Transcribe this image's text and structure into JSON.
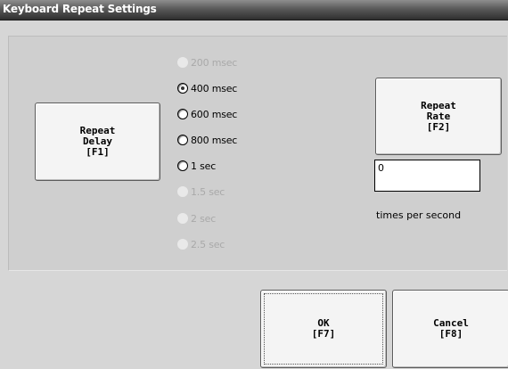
{
  "window": {
    "title": "Keyboard Repeat Settings"
  },
  "repeat_delay": {
    "button_lines": [
      "Repeat",
      "Delay",
      "[F1]"
    ],
    "selected": "400 msec",
    "options": [
      {
        "label": "200 msec",
        "enabled": false
      },
      {
        "label": "400 msec",
        "enabled": true
      },
      {
        "label": "600 msec",
        "enabled": true
      },
      {
        "label": "800 msec",
        "enabled": true
      },
      {
        "label": "1 sec",
        "enabled": true
      },
      {
        "label": "1.5 sec",
        "enabled": false
      },
      {
        "label": "2 sec",
        "enabled": false
      },
      {
        "label": "2.5 sec",
        "enabled": false
      }
    ]
  },
  "repeat_rate": {
    "button_lines": [
      "Repeat",
      "Rate",
      "[F2]"
    ],
    "value": "0",
    "caption": "times per second"
  },
  "actions": {
    "ok_lines": [
      "OK",
      "[F7]"
    ],
    "cancel_lines": [
      "Cancel",
      "[F8]"
    ]
  }
}
